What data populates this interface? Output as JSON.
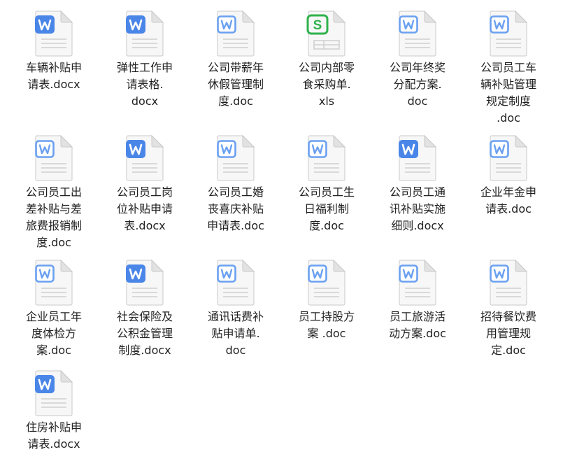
{
  "files": [
    {
      "name": "车辆补贴申请表.docx",
      "lines": [
        "车辆补贴申",
        "请表.docx"
      ],
      "icon": "word-doc-icon",
      "style": "solid"
    },
    {
      "name": "弹性工作申请表格.docx",
      "lines": [
        "弹性工作申",
        "请表格.",
        "docx"
      ],
      "icon": "word-doc-icon",
      "style": "solid"
    },
    {
      "name": "公司带薪年休假管理制度.doc",
      "lines": [
        "公司带薪年",
        "休假管理制",
        "度.doc"
      ],
      "icon": "word-doc-icon",
      "style": "outline"
    },
    {
      "name": "公司内部零食采购单.xls",
      "lines": [
        "公司内部零",
        "食采购单.",
        "xls"
      ],
      "icon": "excel-sheet-icon",
      "style": "sheet"
    },
    {
      "name": "公司年终奖分配方案.doc",
      "lines": [
        "公司年终奖",
        "分配方案.",
        "doc"
      ],
      "icon": "word-doc-icon",
      "style": "outline"
    },
    {
      "name": "公司员工车辆补贴管理规定制度.doc",
      "lines": [
        "公司员工车",
        "辆补贴管理",
        "规定制度",
        ".doc"
      ],
      "icon": "word-doc-icon",
      "style": "outline"
    },
    {
      "name": "公司员工出差补贴与差旅费报销制度.doc",
      "lines": [
        "公司员工出",
        "差补贴与差",
        "旅费报销制",
        "度.doc"
      ],
      "icon": "word-doc-icon",
      "style": "outline"
    },
    {
      "name": "公司员工岗位补贴申请表.docx",
      "lines": [
        "公司员工岗",
        "位补贴申请",
        "表.docx"
      ],
      "icon": "word-doc-icon",
      "style": "solid"
    },
    {
      "name": "公司员工婚丧喜庆补贴申请表.doc",
      "lines": [
        "公司员工婚",
        "丧喜庆补贴",
        "申请表.doc"
      ],
      "icon": "word-doc-icon",
      "style": "outline"
    },
    {
      "name": "公司员工生日福利制度.doc",
      "lines": [
        "公司员工生",
        "日福利制",
        "度.doc"
      ],
      "icon": "word-doc-icon",
      "style": "outline"
    },
    {
      "name": "公司员工通讯补贴实施细则.docx",
      "lines": [
        "公司员工通",
        "讯补贴实施",
        "细则.docx"
      ],
      "icon": "word-doc-icon",
      "style": "solid"
    },
    {
      "name": "企业年金申请表.doc",
      "lines": [
        "企业年金申",
        "请表.doc"
      ],
      "icon": "word-doc-icon",
      "style": "outline"
    },
    {
      "name": "企业员工年度体检方案.doc",
      "lines": [
        "企业员工年",
        "度体检方",
        "案.doc"
      ],
      "icon": "word-doc-icon",
      "style": "outline"
    },
    {
      "name": "社会保险及公积金管理制度.docx",
      "lines": [
        "社会保险及",
        "公积金管理",
        "制度.docx"
      ],
      "icon": "word-doc-icon",
      "style": "solid"
    },
    {
      "name": "通讯话费补贴申请单.doc",
      "lines": [
        "通讯话费补",
        "贴申请单.",
        "doc"
      ],
      "icon": "word-doc-icon",
      "style": "outline"
    },
    {
      "name": "员工持股方案 .doc",
      "lines": [
        "员工持股方",
        "案 .doc"
      ],
      "icon": "word-doc-icon",
      "style": "outline"
    },
    {
      "name": "员工旅游活动方案.doc",
      "lines": [
        "员工旅游活",
        "动方案.doc"
      ],
      "icon": "word-doc-icon",
      "style": "outline"
    },
    {
      "name": "招待餐饮费用管理规定.doc",
      "lines": [
        "招待餐饮费",
        "用管理规",
        "定.doc"
      ],
      "icon": "word-doc-icon",
      "style": "outline"
    },
    {
      "name": "住房补贴申请表.docx",
      "lines": [
        "住房补贴申",
        "请表.docx"
      ],
      "icon": "word-doc-icon",
      "style": "solid"
    }
  ],
  "colors": {
    "word_blue": "#4a86e8",
    "word_blue_light": "#6aa0f0",
    "excel_green": "#2fb24c",
    "page_fill": "#f7f7f7",
    "page_stroke": "#c9c9c9",
    "fold_fill": "#e2e2e2",
    "line_gray": "#cfcfcf",
    "text": "#1f1f1f"
  }
}
